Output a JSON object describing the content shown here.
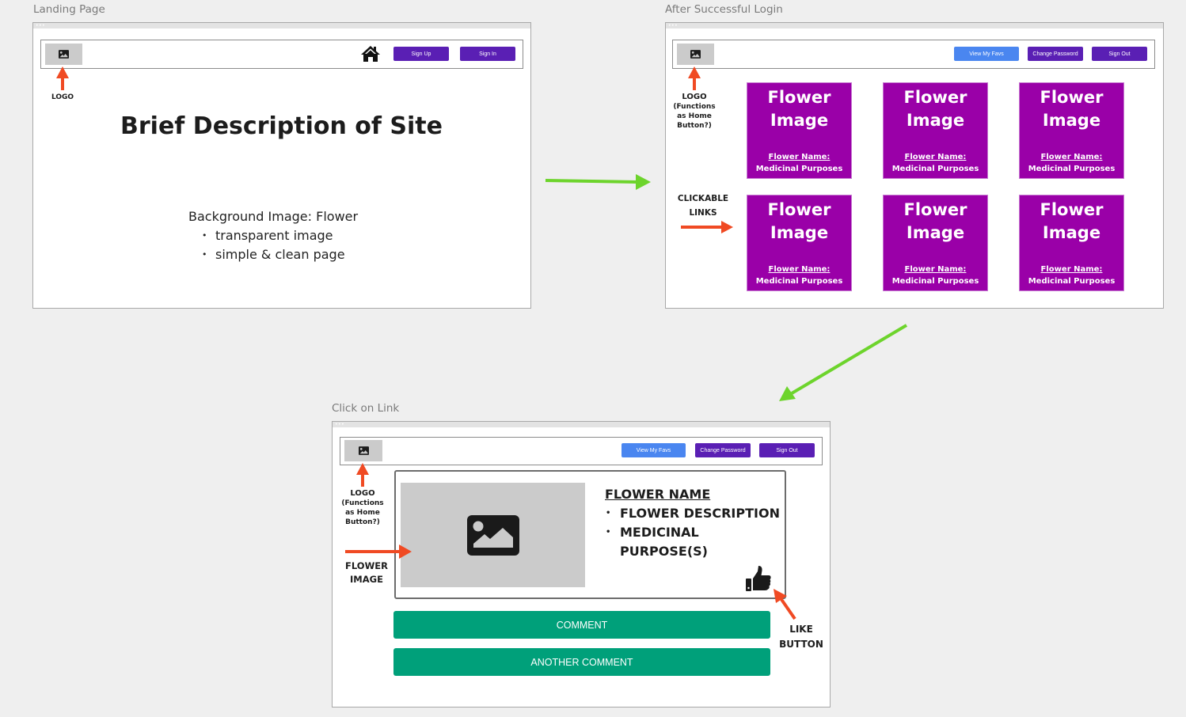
{
  "colors": {
    "canvas_bg": "#efefef",
    "flow_arrow": "#6dd42c",
    "annotation_arrow": "#f04a23",
    "primary_button": "#5a1fb4",
    "secondary_button": "#4a86f0",
    "flower_card": "#9a00a8",
    "comment_button": "#00a07a",
    "placeholder_gray": "#cbcbcb"
  },
  "frames": {
    "landing": {
      "title": "Landing Page",
      "nav": {
        "logo_icon": "image-icon",
        "home_icon": "home-icon",
        "buttons": [
          "Sign Up",
          "Sign In"
        ]
      },
      "annotations": {
        "logo": "LOGO"
      },
      "hero_title": "Brief Description of Site",
      "body": {
        "heading": "Background Image: Flower",
        "bullets": [
          "transparent image",
          "simple & clean page"
        ]
      }
    },
    "after_login": {
      "title": "After Successful Login",
      "nav": {
        "logo_icon": "image-icon",
        "buttons": [
          "View My Favs",
          "Change Password",
          "Sign Out"
        ]
      },
      "annotations": {
        "logo_line1": "LOGO",
        "logo_line2": "(Functions",
        "logo_line3": "as Home",
        "logo_line4": "Button?)",
        "links_line1": "CLICKABLE",
        "links_line2": "LINKS"
      },
      "cards": [
        {
          "title_line1": "Flower",
          "title_line2": "Image",
          "name": "Flower Name:",
          "purpose": "Medicinal Purposes"
        },
        {
          "title_line1": "Flower",
          "title_line2": "Image",
          "name": "Flower Name:",
          "purpose": "Medicinal Purposes"
        },
        {
          "title_line1": "Flower",
          "title_line2": "Image",
          "name": "Flower Name:",
          "purpose": "Medicinal Purposes"
        },
        {
          "title_line1": "Flower",
          "title_line2": "Image",
          "name": "Flower Name:",
          "purpose": "Medicinal Purposes"
        },
        {
          "title_line1": "Flower",
          "title_line2": "Image",
          "name": "Flower Name:",
          "purpose": "Medicinal Purposes"
        },
        {
          "title_line1": "Flower",
          "title_line2": "Image",
          "name": "Flower Name:",
          "purpose": "Medicinal Purposes"
        }
      ]
    },
    "click_on_link": {
      "title": "Click on Link",
      "nav": {
        "logo_icon": "image-icon",
        "buttons": [
          "View My Favs",
          "Change Password",
          "Sign Out"
        ]
      },
      "annotations": {
        "logo_line1": "LOGO",
        "logo_line2": "(Functions",
        "logo_line3": "as Home",
        "logo_line4": "Button?)",
        "image_line1": "FLOWER",
        "image_line2": "IMAGE",
        "like_line1": "LIKE",
        "like_line2": "BUTTON"
      },
      "detail": {
        "image_icon": "image-icon",
        "name": "FLOWER NAME",
        "bullets": [
          "FLOWER DESCRIPTION",
          "MEDICINAL PURPOSE(S)"
        ],
        "like_icon": "thumbs-up-icon"
      },
      "comments": [
        "COMMENT",
        "ANOTHER COMMENT"
      ]
    }
  }
}
